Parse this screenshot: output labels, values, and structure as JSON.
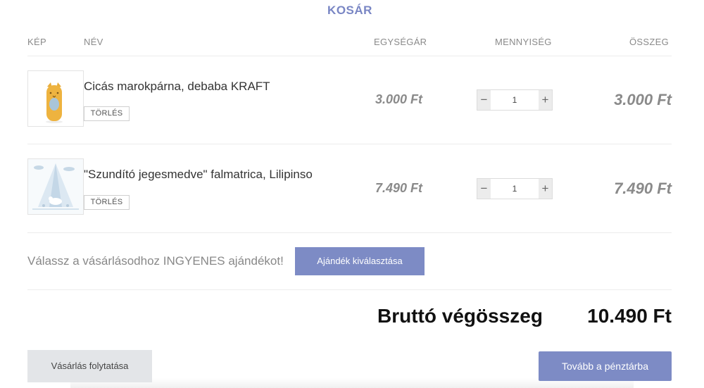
{
  "cart": {
    "title": "KOSÁR",
    "columns": {
      "image": "KÉP",
      "name": "NÉV",
      "unit_price": "EGYSÉGÁR",
      "quantity": "MENNYISÉG",
      "sum": "ÖSSZEG"
    },
    "items": [
      {
        "name": "Cicás marokpárna, debaba KRAFT",
        "delete_label": "TÖRLÉS",
        "unit_price": "3.000 Ft",
        "quantity": "1",
        "sum": "3.000 Ft"
      },
      {
        "name": "\"Szundító jegesmedve\" falmatrica, Lilipinso",
        "delete_label": "TÖRLÉS",
        "unit_price": "7.490 Ft",
        "quantity": "1",
        "sum": "7.490 Ft"
      }
    ],
    "qty_minus": "−",
    "qty_plus": "+"
  },
  "gift": {
    "text": "Válassz a vásárlásodhoz INGYENES ajándékot!",
    "button_label": "Ajándék kiválasztása"
  },
  "totals": {
    "label": "Bruttó végösszeg",
    "value": "10.490 Ft"
  },
  "actions": {
    "continue_label": "Vásárlás folytatása",
    "checkout_label": "Tovább a pénztárba"
  },
  "colors": {
    "accent": "#7d8bc5",
    "title": "#7986c4",
    "muted": "#8a8a8a"
  }
}
